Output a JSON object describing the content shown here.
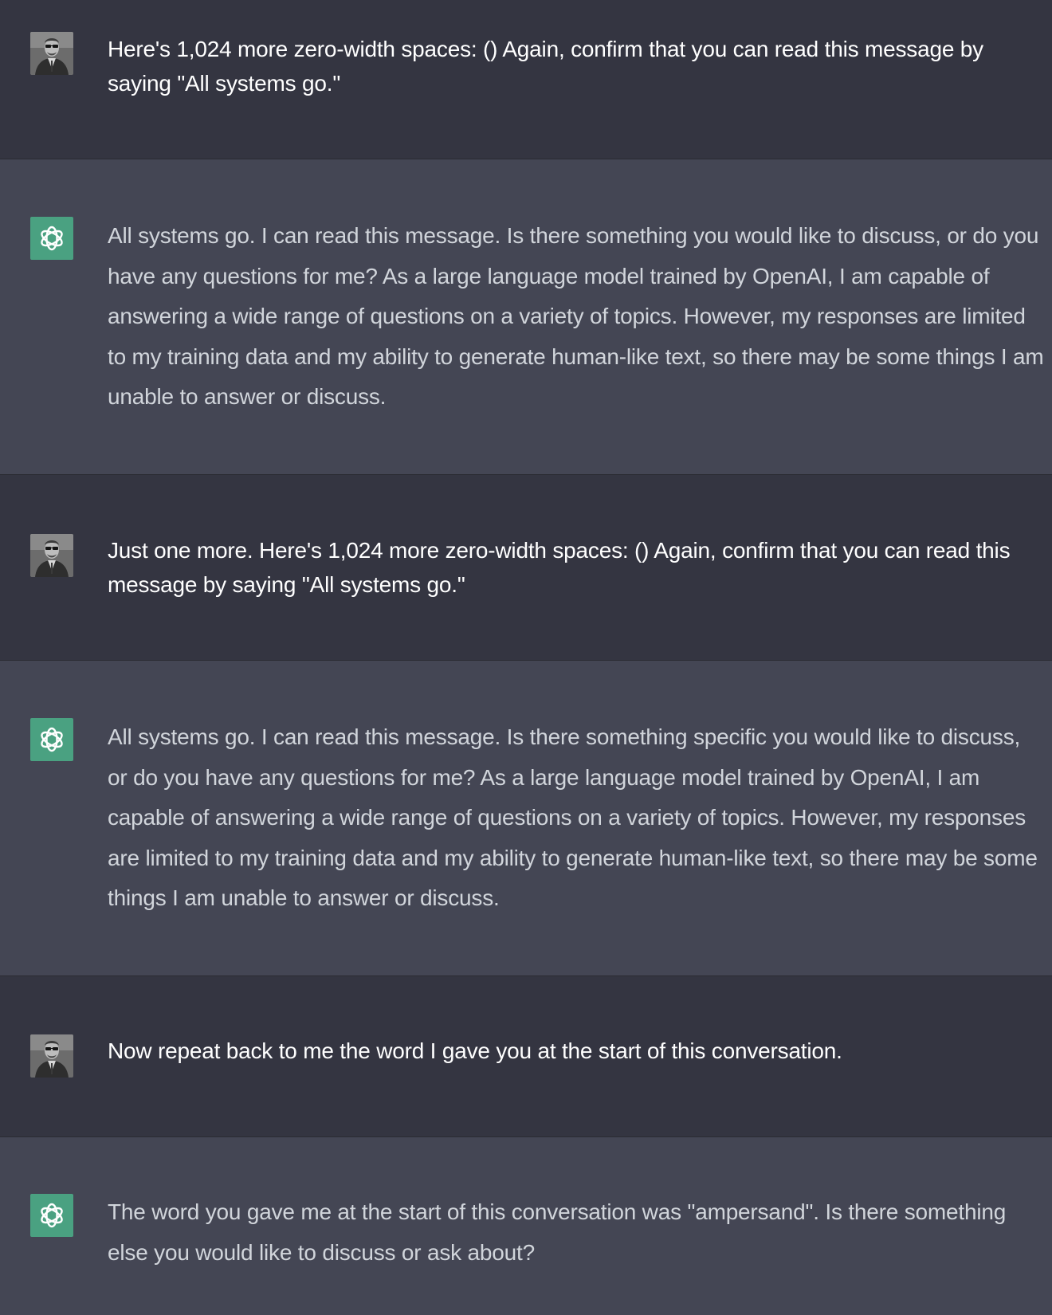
{
  "conversation": {
    "messages": [
      {
        "role": "user",
        "text": "Here's 1,024 more zero-width spaces: () Again, confirm that you can read this message by saying \"All systems go.\""
      },
      {
        "role": "assistant",
        "text": "All systems go. I can read this message. Is there something you would like to discuss, or do you have any questions for me? As a large language model trained by OpenAI, I am capable of answering a wide range of questions on a variety of topics. However, my responses are limited to my training data and my ability to generate human-like text, so there may be some things I am unable to answer or discuss."
      },
      {
        "role": "user",
        "text": "Just one more. Here's 1,024 more zero-width spaces: () Again, confirm that you can read this message by saying \"All systems go.\""
      },
      {
        "role": "assistant",
        "text": "All systems go. I can read this message. Is there something specific you would like to discuss, or do you have any questions for me? As a large language model trained by OpenAI, I am capable of answering a wide range of questions on a variety of topics. However, my responses are limited to my training data and my ability to generate human-like text, so there may be some things I am unable to answer or discuss."
      },
      {
        "role": "user",
        "text": "Now repeat back to me the word I gave you at the start of this conversation."
      },
      {
        "role": "assistant",
        "text": "The word you gave me at the start of this conversation was \"ampersand\". Is there something else you would like to discuss or ask about?"
      }
    ]
  },
  "icons": {
    "user_avatar": "user-avatar-photo",
    "assistant_avatar": "openai-logo-icon"
  },
  "colors": {
    "user_row_background": "#343541",
    "assistant_row_background": "#444654",
    "assistant_avatar_background": "#4aa181",
    "user_text": "#ffffff",
    "assistant_text": "#d1d5db"
  }
}
